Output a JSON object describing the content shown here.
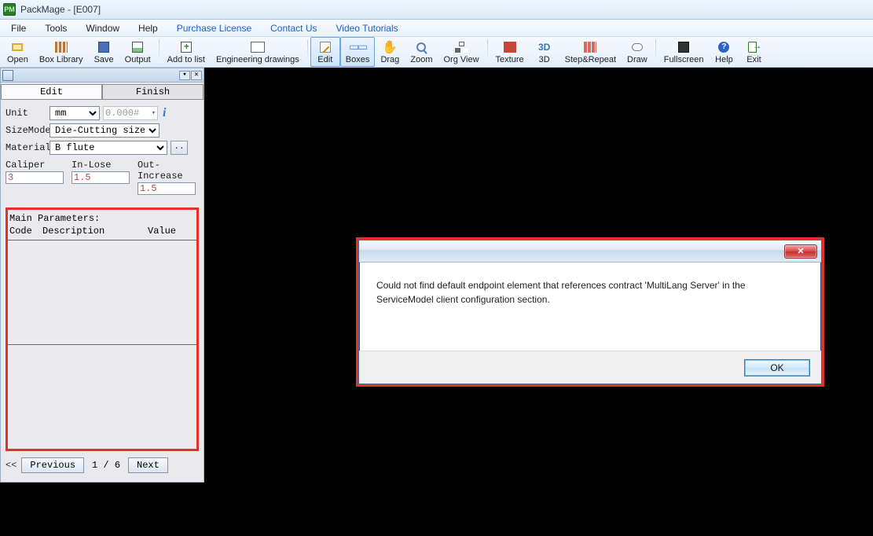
{
  "window": {
    "title": "PackMage - [E007]"
  },
  "menu": {
    "file": "File",
    "tools": "Tools",
    "window": "Window",
    "help": "Help",
    "purchase": "Purchase License",
    "contact": "Contact Us",
    "tutorials": "Video Tutorials"
  },
  "toolbar": {
    "open": "Open",
    "boxlib": "Box Library",
    "save": "Save",
    "output": "Output",
    "addlist": "Add to list",
    "engdraw": "Engineering drawings",
    "edit": "Edit",
    "boxes": "Boxes",
    "drag": "Drag",
    "zoom": "Zoom",
    "orgview": "Org View",
    "texture": "Texture",
    "threeD": "3D",
    "steprep": "Step&Repeat",
    "draw": "Draw",
    "fullscreen": "Fullscreen",
    "helpb": "Help",
    "exit": "Exit"
  },
  "panel": {
    "tabs": {
      "edit": "Edit",
      "finish": "Finish"
    },
    "unit_label": "Unit",
    "unit_value": "mm",
    "num_format": "0.000#",
    "sizemode_label": "SizeMode",
    "sizemode_value": "Die-Cutting size",
    "material_label": "Material",
    "material_value": "B flute",
    "caliper_label": "Caliper",
    "caliper_value": "3",
    "inlose_label": "In-Lose",
    "inlose_value": "1.5",
    "outinc_label": "Out-Increase",
    "outinc_value": "1.5",
    "mainparams_title": "Main Parameters:",
    "col_code": "Code",
    "col_desc": "Description",
    "col_value": "Value",
    "prev": "Previous",
    "page": "1 / 6",
    "next": "Next",
    "arrows": "<<"
  },
  "dialog": {
    "message": "Could not find default endpoint element that references contract 'MultiLang Server' in the ServiceModel client configuration section.",
    "ok": "OK"
  }
}
